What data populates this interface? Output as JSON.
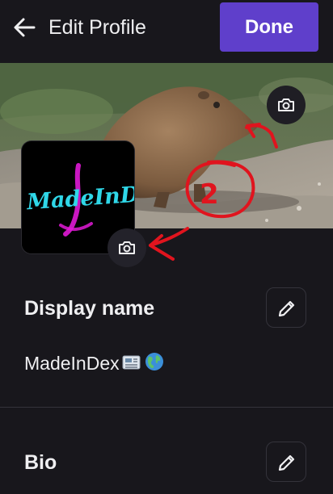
{
  "header": {
    "title": "Edit Profile",
    "done_label": "Done"
  },
  "avatar": {
    "logo_text": "MadeInDex"
  },
  "annotation": {
    "number": "2"
  },
  "display_name": {
    "label": "Display name",
    "value": "MadeInDex"
  },
  "bio": {
    "label": "Bio"
  },
  "icons": {
    "back": "arrow-left-icon",
    "camera": "camera-icon",
    "edit": "pencil-icon",
    "newspaper": "newspaper-emoji",
    "globe": "globe-emoji"
  },
  "colors": {
    "background": "#18171c",
    "accent": "#5f3fcb",
    "annotation_red": "#e0141e",
    "logo_cyan": "#2fd7e8",
    "logo_magenta": "#e01ad6"
  }
}
